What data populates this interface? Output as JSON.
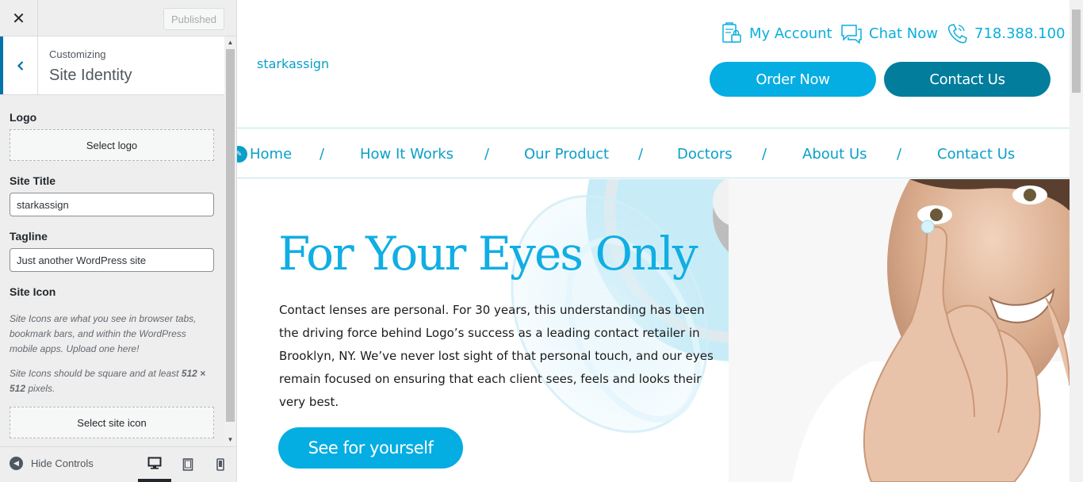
{
  "customizer": {
    "close_glyph": "✕",
    "published_label": "Published",
    "customizing_label": "Customizing",
    "section_title": "Site Identity",
    "logo": {
      "label": "Logo",
      "button": "Select logo"
    },
    "site_title": {
      "label": "Site Title",
      "value": "starkassign"
    },
    "tagline": {
      "label": "Tagline",
      "value": "Just another WordPress site"
    },
    "site_icon": {
      "label": "Site Icon",
      "description": "Site Icons are what you see in browser tabs, bookmark bars, and within the WordPress mobile apps. Upload one here!",
      "size_note_prefix": "Site Icons should be square and at least ",
      "size_note_size": "512 × 512",
      "size_note_suffix": " pixels.",
      "button": "Select site icon"
    },
    "footer": {
      "hide_controls": "Hide Controls",
      "devices": [
        "desktop",
        "tablet",
        "mobile"
      ],
      "active_device": "desktop"
    }
  },
  "site": {
    "title": "starkassign",
    "top_links": [
      {
        "label": "My Account",
        "icon": "account-lock-icon"
      },
      {
        "label": "Chat Now",
        "icon": "chat-bubbles-icon"
      },
      {
        "label": "718.388.100",
        "icon": "phone-icon"
      }
    ],
    "buttons": {
      "order_now": "Order Now",
      "contact_us": "Contact Us"
    },
    "nav": {
      "items": [
        "Home",
        "How It Works",
        "Our Product",
        "Doctors",
        "About Us",
        "Contact Us"
      ],
      "separator": "/"
    },
    "hero": {
      "title": "For Your Eyes Only",
      "body": "Contact lenses are personal. For 30 years, this understanding has been the driving force behind Logo’s success as a leading contact retailer in Brooklyn, NY. We’ve never lost sight of that personal touch, and our eyes remain focused on ensuring that each client sees, feels and looks their very best.",
      "cta": "See for yourself"
    }
  },
  "colors": {
    "accent": "#0aaede",
    "button_primary": "#04ade2",
    "button_secondary": "#027d9c",
    "wp_blue": "#0073aa"
  }
}
